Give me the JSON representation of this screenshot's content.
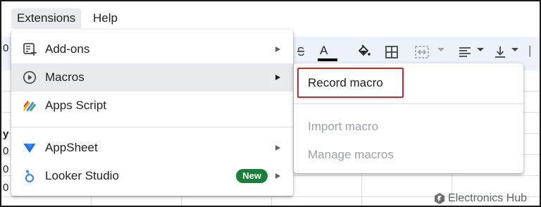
{
  "menubar": {
    "items": [
      {
        "label": "Extensions",
        "open": true
      },
      {
        "label": "Help"
      }
    ]
  },
  "toolbar": {
    "icons": [
      "strikethrough-icon",
      "text-color-icon",
      "fill-color-icon",
      "borders-icon",
      "merge-cells-icon",
      "horizontal-align-icon",
      "vertical-align-icon"
    ],
    "text_color_label": "A",
    "text_color_swatch": "#000000"
  },
  "sheet": {
    "row_glyphs": [
      "y",
      "0",
      "0",
      "0"
    ],
    "left_glyph": "0"
  },
  "extensions_menu": {
    "items": [
      {
        "label": "Add-ons",
        "icon": "add-ons-icon",
        "has_submenu": true
      },
      {
        "label": "Macros",
        "icon": "play-circle-icon",
        "has_submenu": true,
        "active": true
      },
      {
        "label": "Apps Script",
        "icon": "apps-script-icon",
        "has_submenu": false
      },
      {
        "label": "AppSheet",
        "icon": "appsheet-icon",
        "has_submenu": true
      },
      {
        "label": "Looker Studio",
        "icon": "looker-studio-icon",
        "has_submenu": true,
        "badge": "New"
      }
    ],
    "badge_color": "#188038"
  },
  "macros_submenu": {
    "items": [
      {
        "label": "Record macro",
        "enabled": true,
        "highlighted": true
      },
      {
        "label": "Import macro",
        "enabled": false
      },
      {
        "label": "Manage macros",
        "enabled": false
      }
    ],
    "highlight_color": "#c0282b"
  },
  "watermark": {
    "text": "Electronics Hub"
  },
  "colors": {
    "menu_active_bg": "#e8eaed",
    "toolbar_bg": "#edf2fa",
    "disabled_text": "#9aa0a6"
  }
}
